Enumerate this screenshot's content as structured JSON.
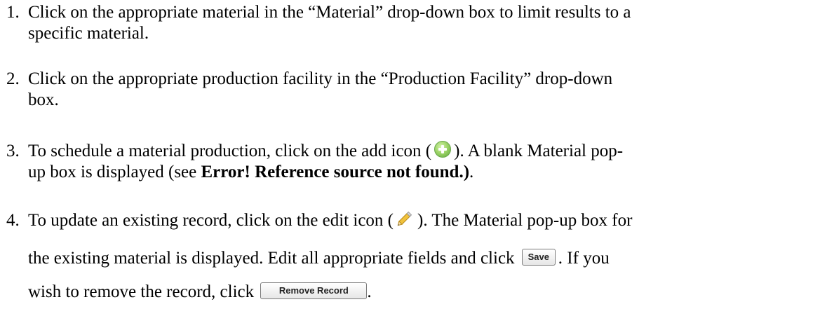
{
  "steps": [
    {
      "number": "1.",
      "line1": "Click on the appropriate material in the “Material” drop-down box to limit results to a",
      "line2": "specific material."
    },
    {
      "number": "2.",
      "line1": "Click on the appropriate production facility in the “Production Facility” drop-down",
      "line2": "box."
    },
    {
      "number": "3.",
      "line1_before_icon": "To schedule a material production, click on the add icon (",
      "line1_after_icon": "). A blank Material pop-",
      "line2_before_bold": "up box is displayed (see ",
      "line2_bold": "Error! Reference source not found.)",
      "line2_after_bold": "."
    },
    {
      "number": "4.",
      "line1_before_icon": "To update an existing record, click on the edit icon (",
      "line1_after_icon": "). The Material pop-up box for",
      "line2_before_button": "the existing material is displayed. Edit all appropriate fields and click",
      "line2_after_button": ". If you",
      "line3_before_button": "wish to remove the record, click",
      "line3_after_button": "."
    }
  ],
  "buttons": {
    "save_label": "Save",
    "remove_label": "Remove Record"
  },
  "icons": {
    "add": "add-icon",
    "edit": "edit-pencil-icon"
  },
  "colors": {
    "add_icon": "#7cc04a",
    "edit_icon": "#e8b830"
  }
}
